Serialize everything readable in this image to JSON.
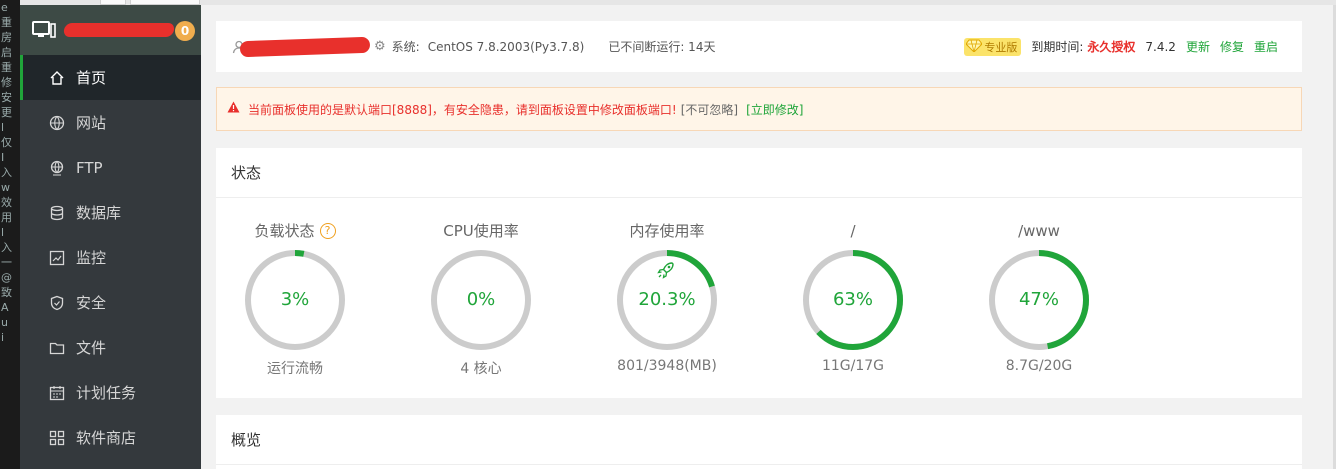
{
  "console_strip": [
    "e",
    "重",
    "房",
    "启",
    "重",
    "修",
    "安",
    "更",
    "l",
    "仅",
    "I",
    "入",
    "w",
    "效",
    "用",
    "l",
    "入",
    "一",
    "@",
    "致",
    "A",
    "u",
    "i"
  ],
  "sidebar": {
    "message_count": "0",
    "items": [
      {
        "label": "首页",
        "icon": "home-icon",
        "active": true
      },
      {
        "label": "网站",
        "icon": "globe-icon",
        "active": false
      },
      {
        "label": "FTP",
        "icon": "ftp-globe-icon",
        "active": false
      },
      {
        "label": "数据库",
        "icon": "database-icon",
        "active": false
      },
      {
        "label": "监控",
        "icon": "monitor-chart-icon",
        "active": false
      },
      {
        "label": "安全",
        "icon": "shield-icon",
        "active": false
      },
      {
        "label": "文件",
        "icon": "folder-icon",
        "active": false
      },
      {
        "label": "计划任务",
        "icon": "calendar-icon",
        "active": false
      },
      {
        "label": "软件商店",
        "icon": "grid-apps-icon",
        "active": false
      }
    ]
  },
  "top_bar": {
    "system_label": "系统:",
    "system_value": "CentOS 7.8.2003(Py3.7.8)",
    "uptime": "已不间断运行: 14天",
    "pro_label": "专业版",
    "expire_label": "到期时间:",
    "expire_value": "永久授权",
    "version": "7.4.2",
    "update": "更新",
    "repair": "修复",
    "restart": "重启"
  },
  "warning": {
    "text": "当前面板使用的是默认端口[8888]，有安全隐患，请到面板设置中修改面板端口!",
    "ignore": "[不可忽略]",
    "fix_link": "[立即修改]"
  },
  "status": {
    "title": "状态",
    "gauges": [
      {
        "title": "负载状态",
        "value": "3%",
        "fraction": 0.03,
        "sub": "运行流畅",
        "help": "?"
      },
      {
        "title": "CPU使用率",
        "value": "0%",
        "fraction": 0.0,
        "sub": "4 核心"
      },
      {
        "title": "内存使用率",
        "value": "20.3%",
        "fraction": 0.203,
        "sub": "801/3948(MB)",
        "rocket": true
      },
      {
        "title": "/",
        "value": "63%",
        "fraction": 0.63,
        "sub": "11G/17G"
      },
      {
        "title": "/www",
        "value": "47%",
        "fraction": 0.47,
        "sub": "8.7G/20G"
      }
    ]
  },
  "overview": {
    "title": "概览"
  },
  "colors": {
    "accent": "#20a53a",
    "danger": "#e8302c",
    "ring_track": "#cccccc",
    "sidebar_bg": "#34393d"
  }
}
